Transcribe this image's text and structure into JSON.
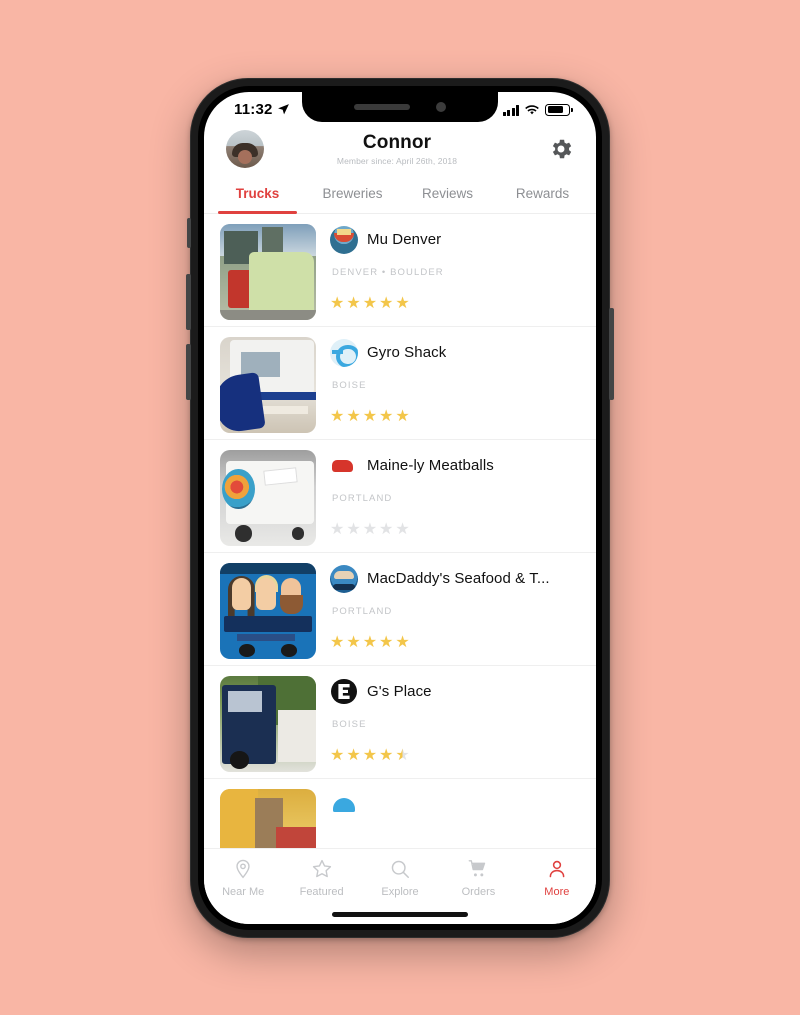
{
  "theme": {
    "accent": "#e0413f",
    "star": "#f3c64a",
    "star_empty": "#e2e3e5",
    "background": "#f9b6a5"
  },
  "status_bar": {
    "time": "11:32",
    "location_icon": "location-arrow-icon",
    "signal_icon": "cellular-signal-icon",
    "wifi_icon": "wifi-icon",
    "battery_icon": "battery-icon"
  },
  "header": {
    "avatar_alt": "user-avatar",
    "name": "Connor",
    "member_since": "Member since: April 26th, 2018",
    "settings_icon": "gear-icon"
  },
  "tabs": [
    {
      "label": "Trucks",
      "active": true
    },
    {
      "label": "Breweries",
      "active": false
    },
    {
      "label": "Reviews",
      "active": false
    },
    {
      "label": "Rewards",
      "active": false
    }
  ],
  "list": [
    {
      "name": "Mu Denver",
      "city": "DENVER • BOULDER",
      "rating": 5,
      "stars": [
        "full",
        "full",
        "full",
        "full",
        "full"
      ]
    },
    {
      "name": "Gyro Shack",
      "city": "BOISE",
      "rating": 5,
      "stars": [
        "full",
        "full",
        "full",
        "full",
        "full"
      ]
    },
    {
      "name": "Maine-ly Meatballs",
      "city": "PORTLAND",
      "rating": 0,
      "stars": [
        "empty",
        "empty",
        "empty",
        "empty",
        "empty"
      ]
    },
    {
      "name": "MacDaddy's Seafood & T...",
      "city": "PORTLAND",
      "rating": 5,
      "stars": [
        "full",
        "full",
        "full",
        "full",
        "full"
      ]
    },
    {
      "name": "G's Place",
      "city": "BOISE",
      "rating": 4.5,
      "stars": [
        "full",
        "full",
        "full",
        "full",
        "half"
      ]
    }
  ],
  "tabbar": [
    {
      "label": "Near Me",
      "icon": "location-pin-icon",
      "active": false
    },
    {
      "label": "Featured",
      "icon": "star-icon",
      "active": false
    },
    {
      "label": "Explore",
      "icon": "search-icon",
      "active": false
    },
    {
      "label": "Orders",
      "icon": "cart-icon",
      "active": false
    },
    {
      "label": "More",
      "icon": "person-icon",
      "active": true
    }
  ]
}
